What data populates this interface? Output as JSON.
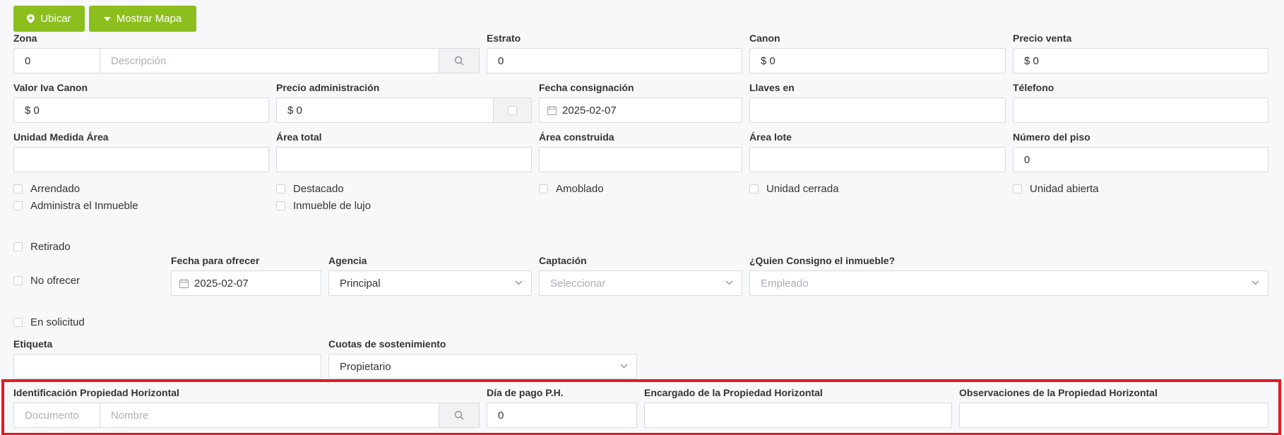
{
  "toolbar": {
    "ubicar": "Ubicar",
    "mostrar_mapa": "Mostrar Mapa"
  },
  "row1": {
    "zona_label": "Zona",
    "zona_code": "0",
    "zona_desc_ph": "Descripción",
    "estrato_label": "Estrato",
    "estrato_value": "0",
    "canon_label": "Canon",
    "canon_value": "$ 0",
    "precio_venta_label": "Precio venta",
    "precio_venta_value": "$ 0"
  },
  "row2": {
    "valor_iva_label": "Valor Iva Canon",
    "valor_iva_value": "$ 0",
    "precio_admin_label": "Precio administración",
    "precio_admin_value": "$ 0",
    "fecha_consig_label": "Fecha consignación",
    "fecha_consig_value": "2025-02-07",
    "llaves_label": "Llaves en",
    "telefono_label": "Télefono"
  },
  "row3": {
    "unidad_medida_label": "Unidad Medida Área",
    "area_total_label": "Área total",
    "area_construida_label": "Área construida",
    "area_lote_label": "Área lote",
    "numero_piso_label": "Número del piso",
    "numero_piso_value": "0"
  },
  "checks": {
    "arrendado": "Arrendado",
    "destacado": "Destacado",
    "amoblado": "Amoblado",
    "unidad_cerrada": "Unidad cerrada",
    "unidad_abierta": "Unidad abierta",
    "administra": "Administra el Inmueble",
    "lujo": "Inmueble de lujo",
    "retirado": "Retirado",
    "no_ofrecer": "No ofrecer",
    "en_solicitud": "En solicitud"
  },
  "row4": {
    "fecha_ofrecer_label": "Fecha para ofrecer",
    "fecha_ofrecer_value": "2025-02-07",
    "agencia_label": "Agencia",
    "agencia_value": "Principal",
    "captacion_label": "Captación",
    "captacion_ph": "Seleccionar",
    "quien_label": "¿Quien Consigno el inmueble?",
    "quien_ph": "Empleado"
  },
  "row5": {
    "etiqueta_label": "Etiqueta",
    "cuotas_label": "Cuotas de sostenimiento",
    "cuotas_value": "Propietario"
  },
  "ph": {
    "ident_label": "Identificación Propiedad Horizontal",
    "doc_ph": "Documento",
    "nombre_ph": "Nombre",
    "dia_pago_label": "Día de pago P.H.",
    "dia_pago_value": "0",
    "encargado_label": "Encargado de la Propiedad Horizontal",
    "observaciones_label": "Observaciones de la Propiedad Horizontal"
  },
  "colors": {
    "accent": "#8cbf1e",
    "highlight": "#e31b23"
  }
}
